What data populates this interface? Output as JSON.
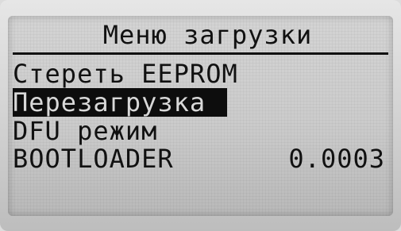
{
  "screen": {
    "title": "Меню загрузки",
    "items": [
      {
        "label": "Стереть EEPROM",
        "selected": false
      },
      {
        "label": "Перезагрузка",
        "selected": true
      },
      {
        "label": "DFU режим",
        "selected": false
      },
      {
        "label": "BOOTLOADER",
        "value": "0.0003",
        "selected": false
      }
    ]
  },
  "colors": {
    "lcd_background": "#cbcbcb",
    "text": "#111111",
    "selection_background": "#0d0d0d",
    "selection_text": "#d8d8d8"
  }
}
